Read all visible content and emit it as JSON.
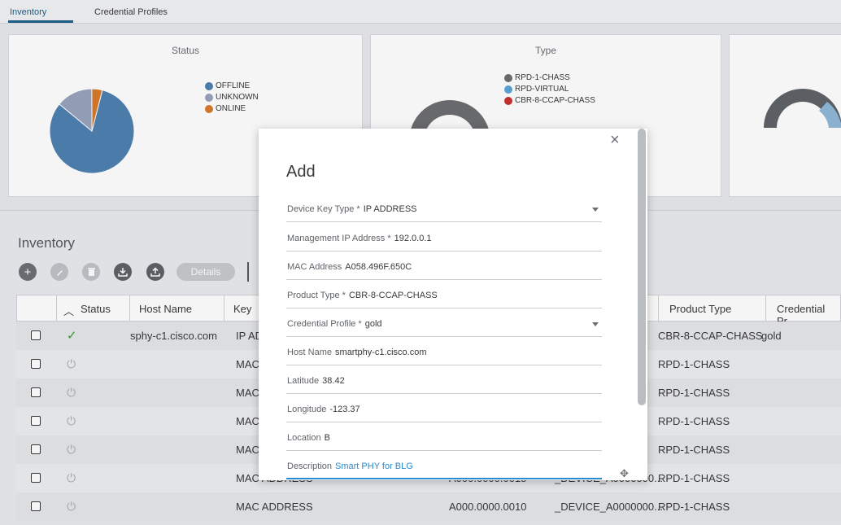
{
  "tabs": [
    {
      "label": "Inventory",
      "active": true
    },
    {
      "label": "Credential Profiles",
      "active": false
    }
  ],
  "status_card": {
    "title": "Status",
    "legend": [
      {
        "label": "OFFLINE",
        "color": "#4f81b0"
      },
      {
        "label": "UNKNOWN",
        "color": "#9aa3bd"
      },
      {
        "label": "ONLINE",
        "color": "#d87a2c"
      }
    ],
    "slices": [
      {
        "label": "OFFLINE",
        "value": 0.82,
        "color": "#4f81b0"
      },
      {
        "label": "UNKNOWN",
        "value": 0.14,
        "color": "#9aa3bd"
      },
      {
        "label": "ONLINE",
        "value": 0.04,
        "color": "#d87a2c"
      }
    ]
  },
  "type_card": {
    "title": "Type",
    "legend": [
      {
        "label": "RPD-1-CHASS",
        "color": "#6d6e71"
      },
      {
        "label": "RPD-VIRTUAL",
        "color": "#5ba4d6"
      },
      {
        "label": "CBR-8-CCAP-CHASS",
        "color": "#c8312f"
      }
    ]
  },
  "inventory": {
    "title": "Inventory",
    "details_label": "Details",
    "columns": [
      "Status",
      "Host Name",
      "Key",
      "Product Type",
      "Credential Pr.."
    ],
    "rows": [
      {
        "status": "ok",
        "host": "sphy-c1.cisco.com",
        "key": "IP AD",
        "mac": "",
        "dev": "...",
        "product": "CBR-8-CCAP-CHASS",
        "cred": "gold"
      },
      {
        "status": "off",
        "host": "",
        "key": "MAC",
        "mac": "",
        "dev": ")...",
        "product": "RPD-1-CHASS",
        "cred": ""
      },
      {
        "status": "off",
        "host": "",
        "key": "MAC",
        "mac": "",
        "dev": ")...",
        "product": "RPD-1-CHASS",
        "cred": ""
      },
      {
        "status": "off",
        "host": "",
        "key": "MAC",
        "mac": "",
        "dev": ")...",
        "product": "RPD-1-CHASS",
        "cred": ""
      },
      {
        "status": "off",
        "host": "",
        "key": "MAC",
        "mac": "",
        "dev": ")...",
        "product": "RPD-1-CHASS",
        "cred": ""
      },
      {
        "status": "off",
        "host": "",
        "key": "MAC ADDRESS",
        "mac": "A000.0000.0015",
        "dev": "_DEVICE_A0000000...",
        "product": "RPD-1-CHASS",
        "cred": ""
      },
      {
        "status": "off",
        "host": "",
        "key": "MAC ADDRESS",
        "mac": "A000.0000.0010",
        "dev": "_DEVICE_A0000000...",
        "product": "RPD-1-CHASS",
        "cred": ""
      }
    ]
  },
  "modal": {
    "title": "Add",
    "fields": [
      {
        "label": "Device Key Type *",
        "value": "IP ADDRESS",
        "dropdown": true
      },
      {
        "label": "Management IP Address  *",
        "value": "192.0.0.1"
      },
      {
        "label": "MAC Address",
        "value": "A058.496F.650C"
      },
      {
        "label": "Product Type *",
        "value": "CBR-8-CCAP-CHASS"
      },
      {
        "label": "Credential Profile  *",
        "value": "gold",
        "dropdown": true
      },
      {
        "label": "Host Name",
        "value": "smartphy-c1.cisco.com"
      },
      {
        "label": "Latitude",
        "value": "38.42"
      },
      {
        "label": "Longitude",
        "value": "-123.37"
      },
      {
        "label": "Location",
        "value": "B"
      },
      {
        "label": "Description",
        "value": "Smart PHY for BLG",
        "active": true
      }
    ]
  }
}
